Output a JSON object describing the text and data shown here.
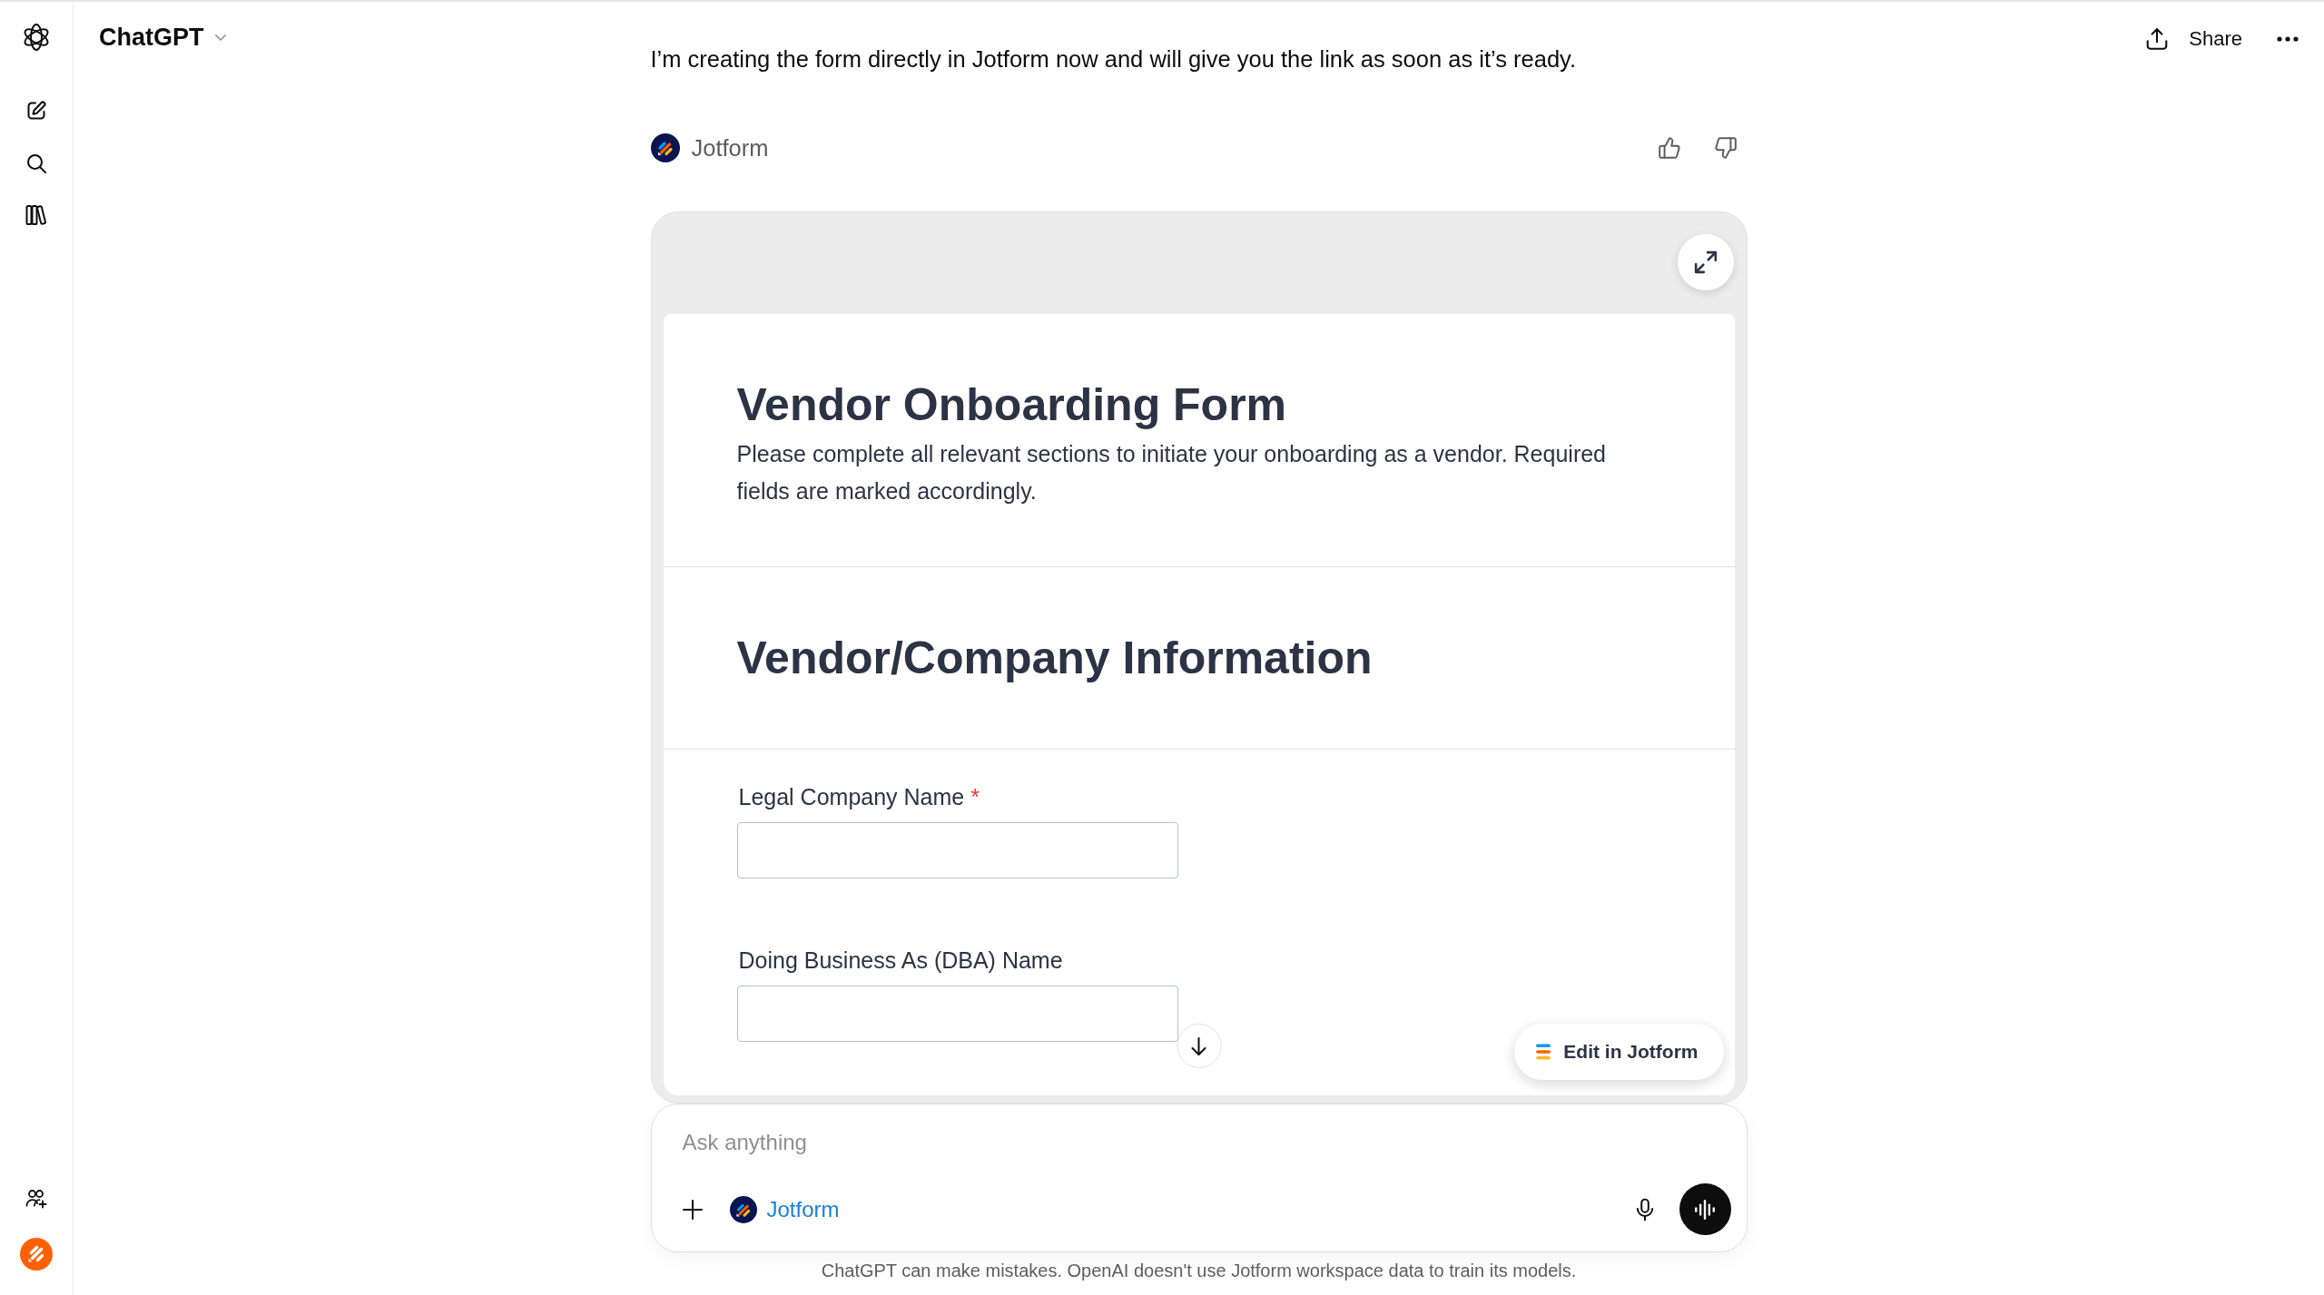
{
  "header": {
    "title": "ChatGPT",
    "share_label": "Share"
  },
  "conversation": {
    "message": "I’m creating the form directly in Jotform now and will give you the link as soon as it’s ready.",
    "tool_label": "Jotform"
  },
  "form_preview": {
    "title": "Vendor Onboarding Form",
    "description": "Please complete all relevant sections to initiate your onboarding as a vendor. Required fields are marked accordingly.",
    "section_heading": "Vendor/Company Information",
    "fields": [
      {
        "label": "Legal Company Name",
        "required_mark": "*"
      },
      {
        "label": "Doing Business As (DBA) Name"
      }
    ],
    "edit_button": "Edit in Jotform"
  },
  "composer": {
    "placeholder": "Ask anything",
    "tool_chip": "Jotform"
  },
  "disclaimer": "ChatGPT can make mistakes. OpenAI doesn't use Jotform workspace data to train its models."
}
